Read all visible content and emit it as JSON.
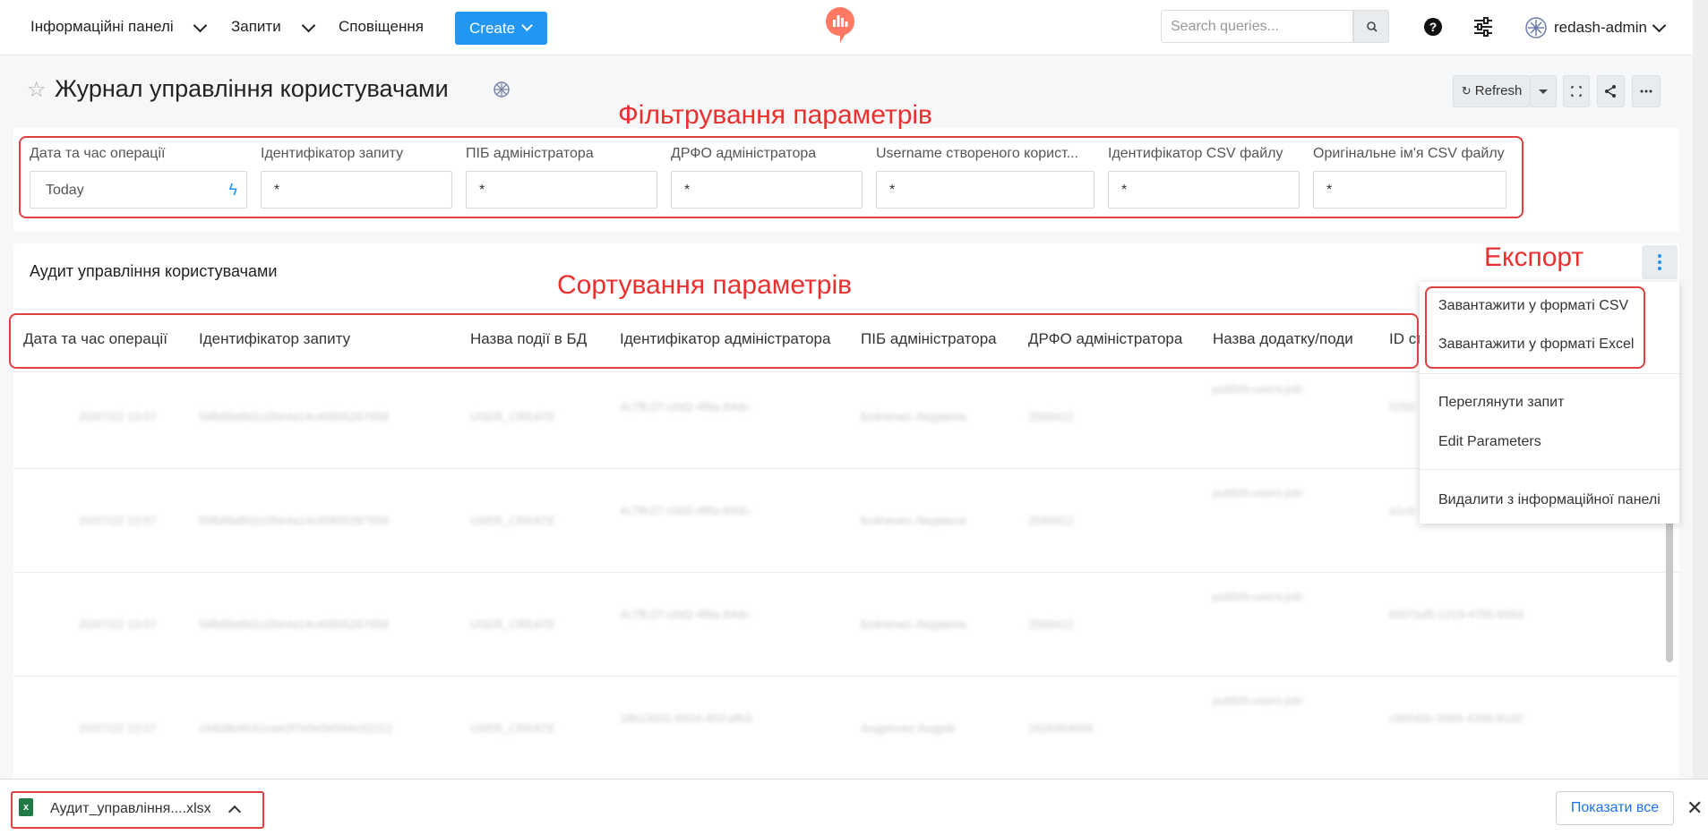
{
  "navbar": {
    "dashboards": "Інформаційні панелі",
    "queries": "Запити",
    "alerts": "Сповіщення",
    "create": "Create",
    "search_placeholder": "Search queries...",
    "help": "?",
    "user": "redash-admin"
  },
  "page": {
    "title": "Журнал управління користувачами",
    "refresh": "Refresh"
  },
  "annotations": {
    "filter": "Фільтрування параметрів",
    "sort": "Сортування параметрів",
    "export": "Експорт"
  },
  "filters": [
    {
      "label": "Дата та час операції",
      "value": "Today"
    },
    {
      "label": "Ідентифікатор запиту",
      "value": "*"
    },
    {
      "label": "ПІБ адміністратора",
      "value": "*"
    },
    {
      "label": "ДРФО адміністратора",
      "value": "*"
    },
    {
      "label": "Username створеного корист...",
      "value": "*"
    },
    {
      "label": "Ідентифікатор CSV файлу",
      "value": "*"
    },
    {
      "label": "Оригінальне ім'я CSV файлу",
      "value": "*"
    }
  ],
  "widget": {
    "title": "Аудит управління користувачами",
    "columns": [
      "Дата та час операції",
      "Ідентифікатор запиту",
      "Назва події в БД",
      "Ідентифікатор адміністратора",
      "ПІБ адміністратора",
      "ДРФО адміністратора",
      "Назва додатку/поди",
      "ID ст"
    ],
    "rows": [
      [
        "20/07/22 10:57",
        "59fb8fa8fd1c05e4a14c45805287958",
        "USER_CREATE",
        "4c7ffc27-c0d2-4f8a-84dc-",
        "Бойченко Людмила",
        "2589412",
        "publish-users-job-",
        "5260"
      ],
      [
        "20/07/22 10:57",
        "59fb8fa8fd1c05e4a14c45805287958",
        "USER_CREATE",
        "4c7ffc27-c0d2-4f8a-84dc-",
        "Бойченко Людмила",
        "2589412",
        "publish-users-job-",
        "a1c6"
      ],
      [
        "20/07/22 10:57",
        "59fb8fa8fd1c05e4a14c45805287958",
        "USER_CREATE",
        "4c7ffc27-c0d2-4f8a-84dc-",
        "Бойченко Людмила",
        "2589412",
        "publish-users-job-",
        "b507ad5-1219-4785-b564"
      ],
      [
        "20/07/22 10:07",
        "c94b8b4fc61eae2f7e5e5b594e32213",
        "USER_CREATE",
        "18b13d31-6824-4f1f-af63-",
        "Андрієнко Андрій",
        "1626364656",
        "publish-users-job-",
        "c9654dc-9964-4346-81d2"
      ]
    ]
  },
  "menu": {
    "csv": "Завантажити у форматі CSV",
    "excel": "Завантажити у форматі Excel",
    "view_query": "Переглянути запит",
    "edit_params": "Edit Parameters",
    "remove": "Видалити з інформаційної панелі"
  },
  "download": {
    "file": "Аудит_управління....xlsx",
    "show_all": "Показати все"
  },
  "colors": {
    "accent": "#2196f3",
    "annotation": "#e8312f",
    "logo": "#ff7964"
  }
}
